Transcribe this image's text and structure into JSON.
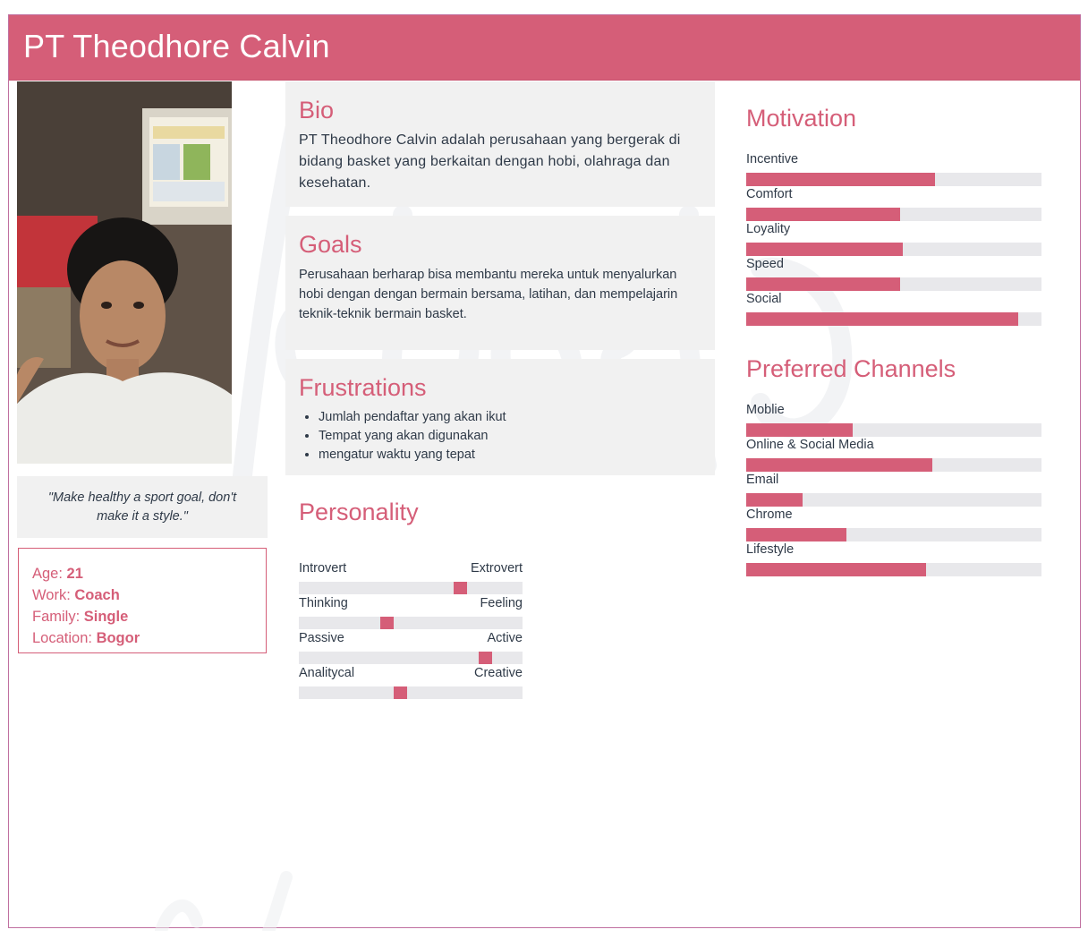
{
  "title": "PT Theodhore Calvin",
  "quote": "\"Make healthy a sport goal, don't make it a style.\"",
  "facts": [
    {
      "key": "Age:",
      "value": "21"
    },
    {
      "key": "Work:",
      "value": "Coach"
    },
    {
      "key": "Family:",
      "value": "Single"
    },
    {
      "key": "Location:",
      "value": "Bogor"
    }
  ],
  "bio": {
    "heading": "Bio",
    "text": "PT Theodhore Calvin adalah perusahaan yang bergerak di bidang basket yang berkaitan dengan hobi, olahraga dan kesehatan."
  },
  "goals": {
    "heading": "Goals",
    "text": "Perusahaan berharap bisa membantu mereka untuk menyalurkan hobi dengan dengan bermain bersama, latihan, dan mempelajarin teknik-teknik bermain basket."
  },
  "frustrations": {
    "heading": "Frustrations",
    "items": [
      "Jumlah pendaftar yang akan ikut",
      "Tempat yang akan digunakan",
      "mengatur waktu yang tepat"
    ]
  },
  "personality": {
    "heading": "Personality",
    "traits": [
      {
        "left": "Introvert",
        "right": "Extrovert",
        "value": 0.72
      },
      {
        "left": "Thinking",
        "right": "Feeling",
        "value": 0.39
      },
      {
        "left": "Passive",
        "right": "Active",
        "value": 0.83
      },
      {
        "left": "Analitycal",
        "right": "Creative",
        "value": 0.45
      }
    ]
  },
  "motivation": {
    "heading": "Motivation",
    "items": [
      {
        "label": "Incentive",
        "value": 0.64
      },
      {
        "label": "Comfort",
        "value": 0.52
      },
      {
        "label": "Loyality",
        "value": 0.53
      },
      {
        "label": "Speed",
        "value": 0.52
      },
      {
        "label": "Social",
        "value": 0.92
      }
    ]
  },
  "channels": {
    "heading": "Preferred Channels",
    "items": [
      {
        "label": "Moblie",
        "value": 0.36
      },
      {
        "label": "Online & Social Media",
        "value": 0.63
      },
      {
        "label": "Email",
        "value": 0.19
      },
      {
        "label": "Chrome",
        "value": 0.34
      },
      {
        "label": "Lifestyle",
        "value": 0.61
      }
    ]
  },
  "colors": {
    "accent": "#d55e78",
    "track": "#e8e8eb",
    "card": "#f1f1f1",
    "text": "#2f3a48"
  }
}
